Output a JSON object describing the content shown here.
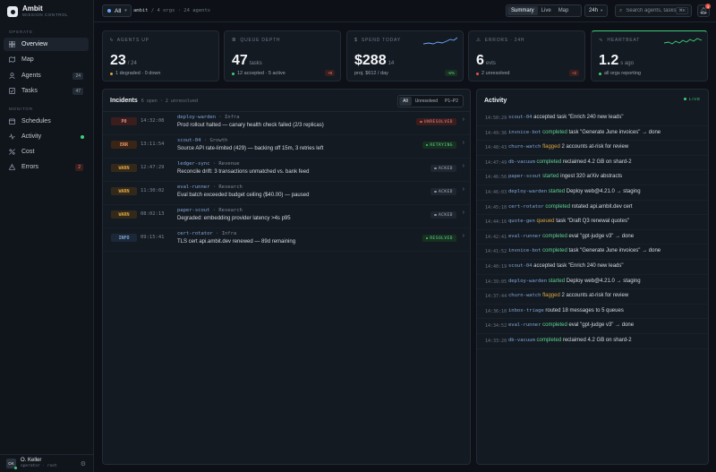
{
  "brand": {
    "name": "Ambit",
    "subtitle": "MISSION CONTROL"
  },
  "sidebar": {
    "section_operate": "OPERATE",
    "section_monitor": "MONITOR",
    "items": [
      {
        "label": "Overview",
        "icon": "grid-icon",
        "active": true
      },
      {
        "label": "Map",
        "icon": "map-icon"
      },
      {
        "label": "Agents",
        "icon": "agents-icon",
        "badge": "24"
      },
      {
        "label": "Tasks",
        "icon": "check-icon",
        "badge": "47"
      },
      {
        "label": "Schedules",
        "icon": "calendar-icon"
      },
      {
        "label": "Activity",
        "icon": "pulse-icon",
        "live_dot": true
      },
      {
        "label": "Cost",
        "icon": "dollar-icon"
      },
      {
        "label": "Errors",
        "icon": "warning-icon",
        "badge": "2"
      }
    ]
  },
  "user": {
    "initials": "OK",
    "name": "O. Keller",
    "role": "operator · root"
  },
  "topbar": {
    "org_label": "All",
    "crumb_root": "ambit",
    "crumb_sep": "/",
    "crumb_rest": "4 orgs · 24 agents",
    "views": [
      "Summary",
      "Live",
      "Map"
    ],
    "active_view": "Summary",
    "range": "24h",
    "search_placeholder": "Search agents, tasks…",
    "search_kbd": "⌘K",
    "notifications": "3"
  },
  "kpis": {
    "agents": {
      "label": "AGENTS UP",
      "value": "23",
      "unit": "/ 24",
      "foot": "1 degraded · 0 down"
    },
    "queue": {
      "label": "QUEUE DEPTH",
      "value": "47",
      "unit": "tasks",
      "foot": "12 accepted · 5 active",
      "delta": "+8"
    },
    "spend": {
      "label": "SPEND TODAY",
      "value": "$288",
      "unit": "14",
      "foot": "proj. $612 / day",
      "delta": "-6%"
    },
    "errors": {
      "label": "ERRORS · 24H",
      "value": "6",
      "unit": "evts",
      "foot": "2 unresolved",
      "delta": "+2"
    },
    "heartbeat": {
      "label": "HEARTBEAT",
      "value": "1.2",
      "unit": "s ago",
      "foot": "all orgs reporting"
    }
  },
  "colors": {
    "accent_green": "#3fcf7a",
    "error_red": "#e5534b",
    "warn_amber": "#d9a441",
    "info_blue": "#7fa6d6"
  },
  "incidents": {
    "title": "Incidents",
    "meta": "6 open · 2 unresolved",
    "filters": [
      "All",
      "Unresolved",
      "P1–P2"
    ],
    "active_filter": "All",
    "rows": [
      {
        "sev": "P0",
        "time": "14:32:08",
        "agent": "deploy-warden",
        "org": "Infra",
        "msg": "Prod rollout halted — canary health check failed (2/3 replicas)",
        "status": "UNRESOLVED"
      },
      {
        "sev": "ERR",
        "time": "13:11:54",
        "agent": "scout-04",
        "org": "Growth",
        "msg": "Source API rate-limited (429) — backing off 15m, 3 retries left",
        "status": "RETRYING"
      },
      {
        "sev": "WARN",
        "time": "12:47:29",
        "agent": "ledger-sync",
        "org": "Revenue",
        "msg": "Reconcile drift: 3 transactions unmatched vs. bank feed",
        "status": "ACKED"
      },
      {
        "sev": "WARN",
        "time": "11:30:02",
        "agent": "eval-runner",
        "org": "Research",
        "msg": "Eval batch exceeded budget ceiling ($40.00) — paused",
        "status": "ACKED"
      },
      {
        "sev": "WARN",
        "time": "08:02:13",
        "agent": "paper-scout",
        "org": "Research",
        "msg": "Degraded: embedding provider latency >4s p95",
        "status": "ACKED"
      },
      {
        "sev": "INFO",
        "time": "09:15:41",
        "agent": "cert-rotator",
        "org": "Infra",
        "msg": "TLS cert api.ambit.dev renewed — 89d remaining",
        "status": "RESOLVED"
      }
    ]
  },
  "activity": {
    "title": "Activity",
    "live_label": "LIVE",
    "rows": [
      {
        "time": "14:50:29",
        "agent": "scout-04",
        "verb": "accepted",
        "rest": "task \"Enrich 240 new leads\""
      },
      {
        "time": "14:49:36",
        "agent": "invoice-bot",
        "verb": "completed",
        "rest": "task \"Generate June invoices\" → done"
      },
      {
        "time": "14:48:43",
        "agent": "churn-watch",
        "verb": "flagged",
        "rest": "2 accounts at-risk for review"
      },
      {
        "time": "14:47:49",
        "agent": "db-vacuum",
        "verb": "completed",
        "rest": "reclaimed 4.2 GB on shard-2"
      },
      {
        "time": "14:46:56",
        "agent": "paper-scout",
        "verb": "started",
        "rest": "ingest 320 arXiv abstracts"
      },
      {
        "time": "14:46:03",
        "agent": "deploy-warden",
        "verb": "started",
        "rest": "Deploy web@4.21.0 → staging"
      },
      {
        "time": "14:45:10",
        "agent": "cert-rotator",
        "verb": "completed",
        "rest": "rotated api.ambit.dev cert"
      },
      {
        "time": "14:44:16",
        "agent": "quote-gen",
        "verb": "queued",
        "rest": "task \"Draft Q3 renewal quotes\""
      },
      {
        "time": "14:42:41",
        "agent": "eval-runner",
        "verb": "completed",
        "rest": "eval \"gpt-judge v3\" → done"
      },
      {
        "time": "14:41:52",
        "agent": "invoice-bot",
        "verb": "completed",
        "rest": "task \"Generate June invoices\" → done"
      },
      {
        "time": "14:40:19",
        "agent": "scout-04",
        "verb": "accepted",
        "rest": "task \"Enrich 240 new leads\""
      },
      {
        "time": "14:39:05",
        "agent": "deploy-warden",
        "verb": "started",
        "rest": "Deploy web@4.21.0 → staging"
      },
      {
        "time": "14:37:44",
        "agent": "churn-watch",
        "verb": "flagged",
        "rest": "2 accounts at-risk for review"
      },
      {
        "time": "14:36:10",
        "agent": "inbox-triage",
        "verb": "routed",
        "rest": "18 messages to 5 queues"
      },
      {
        "time": "14:34:52",
        "agent": "eval-runner",
        "verb": "completed",
        "rest": "eval \"gpt-judge v3\" → done"
      },
      {
        "time": "14:33:20",
        "agent": "db-vacuum",
        "verb": "completed",
        "rest": "reclaimed 4.2 GB on shard-2"
      }
    ]
  }
}
